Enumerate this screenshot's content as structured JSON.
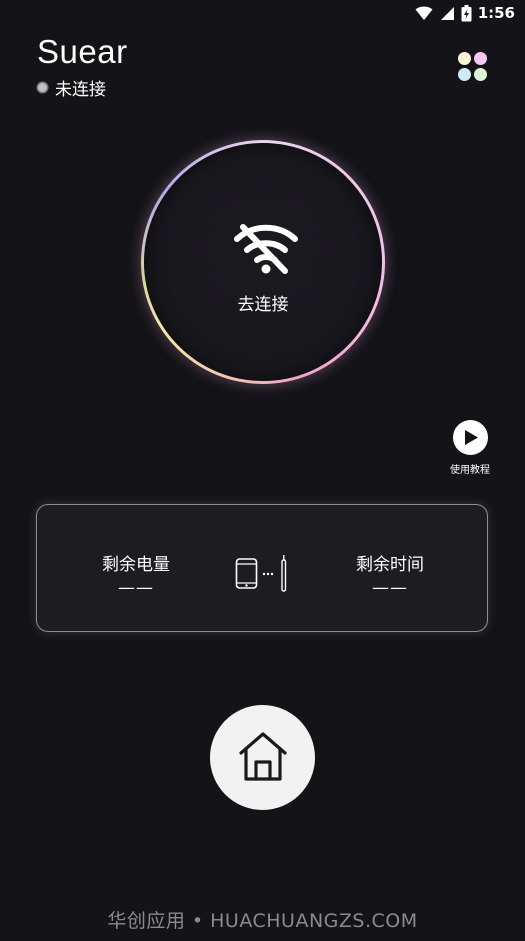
{
  "status_bar": {
    "time": "1:56",
    "icons": [
      "wifi-icon",
      "signal-icon",
      "battery-icon"
    ]
  },
  "header": {
    "app_title": "Suear",
    "connection_status": "未连接",
    "menu_icon": "four-dots-grid-icon"
  },
  "connect": {
    "label": "去连接",
    "icon": "wifi-off-icon"
  },
  "tutorial": {
    "label": "使用教程",
    "icon": "play-icon"
  },
  "battery_card": {
    "battery_label": "剩余电量",
    "battery_value": "——",
    "time_label": "剩余时间",
    "time_value": "——",
    "icon": "phone-earpick-link-icon"
  },
  "home": {
    "icon": "home-icon"
  },
  "watermark": {
    "text": "华创应用 • HUACHUANGZS.COM"
  },
  "colors": {
    "background": "#141317",
    "ring_gradient": [
      "#e8d6f0",
      "#f5b6e0",
      "#f4e9a6",
      "#b7a7ea"
    ],
    "dots": [
      "#fdf7d8",
      "#f4c9ef",
      "#cfeaf3",
      "#def4d4"
    ]
  }
}
